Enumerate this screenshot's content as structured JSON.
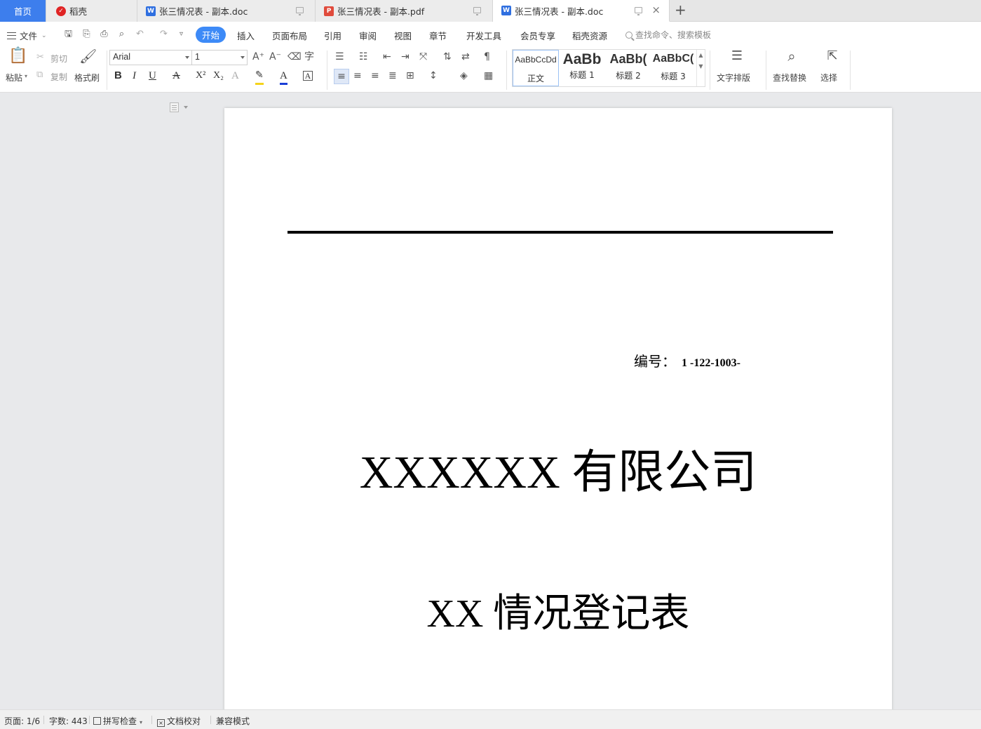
{
  "tabs": {
    "home": "首页",
    "daoke": "稻壳",
    "doc1": "张三情况表 - 副本.doc",
    "pdf": "张三情况表 - 副本.pdf",
    "doc2": "张三情况表 - 副本.doc",
    "add": "+",
    "close": "×"
  },
  "menu": {
    "file": "文件",
    "items": [
      "开始",
      "插入",
      "页面布局",
      "引用",
      "审阅",
      "视图",
      "章节",
      "开发工具",
      "会员专享",
      "稻壳资源"
    ],
    "search_placeholder": "查找命令、搜索模板"
  },
  "ribbon": {
    "paste": "粘贴",
    "cut": "剪切",
    "copy": "复制",
    "format_painter": "格式刷",
    "font_name": "Arial",
    "font_size": "1",
    "styles": [
      {
        "sample": "AaBbCcDd",
        "name": "正文"
      },
      {
        "sample": "AaBb",
        "name": "标题 1"
      },
      {
        "sample": "AaBb(",
        "name": "标题 2"
      },
      {
        "sample": "AaBbC(",
        "name": "标题 3"
      }
    ],
    "text_layout": "文字排版",
    "find_replace": "查找替换",
    "select": "选择"
  },
  "document": {
    "number_label": "编号：",
    "number_value": "1 -122-1003-",
    "company": "XXXXXX 有限公司",
    "subtitle": "XX 情况登记表"
  },
  "status": {
    "page": "页面: 1/6",
    "words": "字数: 443",
    "spell_check": "拼写检查",
    "proofread": "文档校对",
    "compat": "兼容模式"
  }
}
